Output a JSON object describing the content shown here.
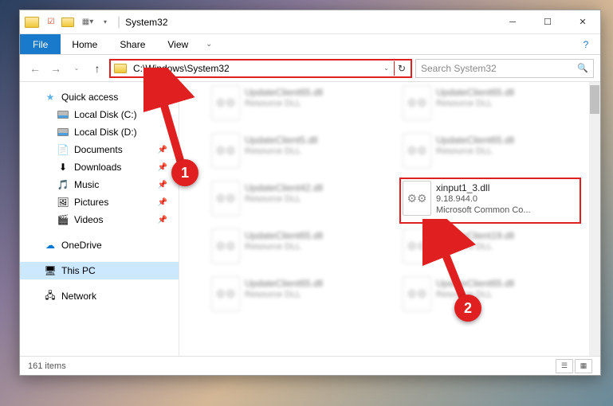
{
  "window": {
    "title": "System32",
    "path_display": "C:\\Windows\\System32",
    "search_placeholder": "Search System32"
  },
  "menu": {
    "file": "File",
    "home": "Home",
    "share": "Share",
    "view": "View"
  },
  "sidebar": {
    "quick_access": "Quick access",
    "local_c": "Local Disk (C:)",
    "local_d": "Local Disk (D:)",
    "documents": "Documents",
    "downloads": "Downloads",
    "music": "Music",
    "pictures": "Pictures",
    "videos": "Videos",
    "onedrive": "OneDrive",
    "this_pc": "This PC",
    "network": "Network"
  },
  "files": {
    "blur_name": "UpdateClient65.dll",
    "blur_type": "Resource DLL",
    "blur_name2": "UpdateClient5.dll",
    "blur_name3": "UpdateClient42.dll",
    "blur_name4": "UpdateClient19.dll",
    "target_name": "xinput1_3.dll",
    "target_ver": "9.18.944.0",
    "target_desc": "Microsoft Common Co..."
  },
  "status": {
    "count": "161 items"
  },
  "callouts": {
    "one": "1",
    "two": "2"
  }
}
